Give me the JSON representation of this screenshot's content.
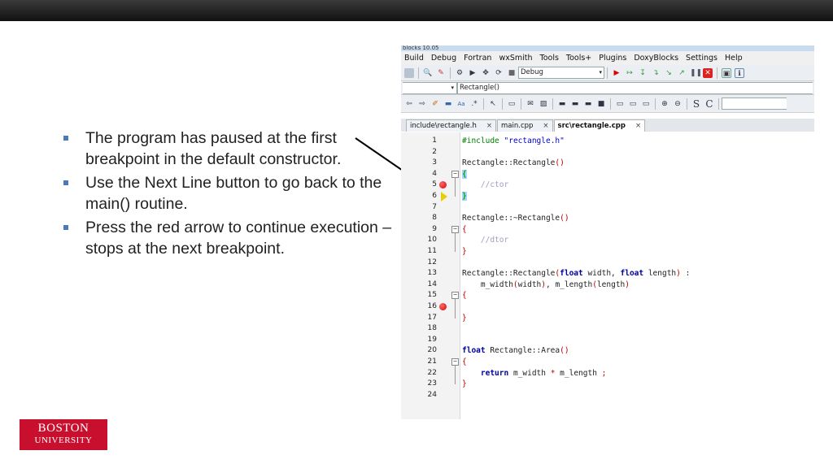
{
  "slide": {
    "bullets": [
      "The program has paused at the first breakpoint in the default constructor.",
      "Use the Next Line button to go back to the main() routine.",
      "Press the red arrow to continue execution – stops at the next breakpoint."
    ],
    "logo": {
      "line1": "BOSTON",
      "line2": "UNIVERSITY"
    }
  },
  "ide": {
    "title_fragment": "blocks 10.05",
    "menu": [
      "Build",
      "Debug",
      "Fortran",
      "wxSmith",
      "Tools",
      "Tools+",
      "Plugins",
      "DoxyBlocks",
      "Settings",
      "Help"
    ],
    "build_target": "Debug",
    "symbol_combo": "Rectangle()",
    "tabs": [
      {
        "label": "include\\rectangle.h",
        "close": "×"
      },
      {
        "label": "main.cpp",
        "close": "×"
      },
      {
        "label": "src\\rectangle.cpp",
        "close": "×"
      }
    ],
    "active_tab": "src\\rectangle.cpp",
    "breakpoint_lines": [
      5,
      16
    ],
    "current_line": 6,
    "lines": [
      {
        "n": "1",
        "t": "#include \"rectangle.h\""
      },
      {
        "n": "2",
        "t": ""
      },
      {
        "n": "3",
        "t": "Rectangle::Rectangle()"
      },
      {
        "n": "4",
        "t": "{"
      },
      {
        "n": "5",
        "t": "    //ctor"
      },
      {
        "n": "6",
        "t": "}"
      },
      {
        "n": "7",
        "t": ""
      },
      {
        "n": "8",
        "t": "Rectangle::~Rectangle()"
      },
      {
        "n": "9",
        "t": "{"
      },
      {
        "n": "10",
        "t": "    //dtor"
      },
      {
        "n": "11",
        "t": "}"
      },
      {
        "n": "12",
        "t": ""
      },
      {
        "n": "13",
        "t": "Rectangle::Rectangle(float width, float length) :"
      },
      {
        "n": "14",
        "t": "    m_width(width), m_length(length)"
      },
      {
        "n": "15",
        "t": "{"
      },
      {
        "n": "16",
        "t": ""
      },
      {
        "n": "17",
        "t": "}"
      },
      {
        "n": "18",
        "t": ""
      },
      {
        "n": "19",
        "t": ""
      },
      {
        "n": "20",
        "t": "float Rectangle::Area()"
      },
      {
        "n": "21",
        "t": "{"
      },
      {
        "n": "22",
        "t": "    return m_width * m_length ;"
      },
      {
        "n": "23",
        "t": "}"
      },
      {
        "n": "24",
        "t": ""
      }
    ]
  }
}
